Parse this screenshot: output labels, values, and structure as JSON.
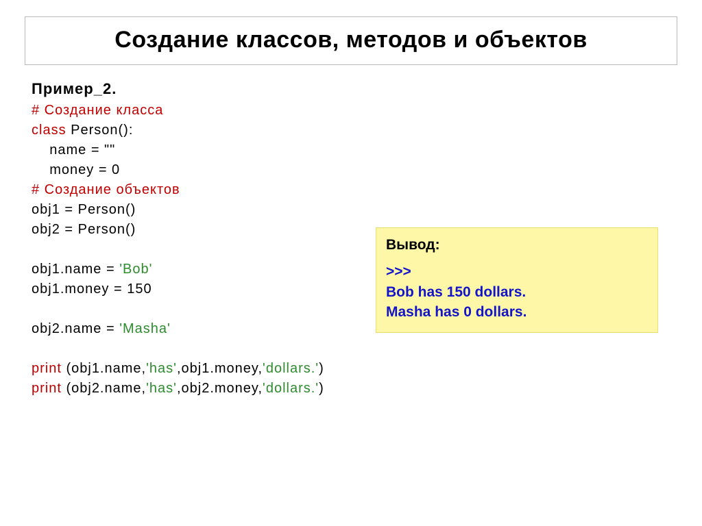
{
  "title": "Создание классов, методов и объектов",
  "subheading": "Пример_2.",
  "code": {
    "comment1": "# Создание класса",
    "class_kw": "class",
    "class_decl_rest": " Person():",
    "name_line": "    name = \"\"",
    "money_line": "    money = 0",
    "comment2": "# Создание объектов",
    "obj1_decl": "obj1 = Person()",
    "obj2_decl": "obj2 = Person()",
    "blank": "",
    "obj1_name_pre": "obj1.name = ",
    "obj1_name_str": "'Bob'",
    "obj1_money": "obj1.money = 150",
    "obj2_name_pre": "obj2.name = ",
    "obj2_name_str": "'Masha'",
    "print_kw": "print",
    "print1_open": " (obj1.name,",
    "print_has": "'has'",
    "print1_mid": ",obj1.money,",
    "print_dollars": "'dollars.'",
    "print1_close": ")",
    "print2_open": " (obj2.name,",
    "print2_mid": ",obj2.money,",
    "print2_close": ")"
  },
  "output": {
    "title": "Вывод:",
    "prompt": ">>>",
    "line1": "Bob has 150 dollars.",
    "line2": "Masha has 0 dollars."
  }
}
